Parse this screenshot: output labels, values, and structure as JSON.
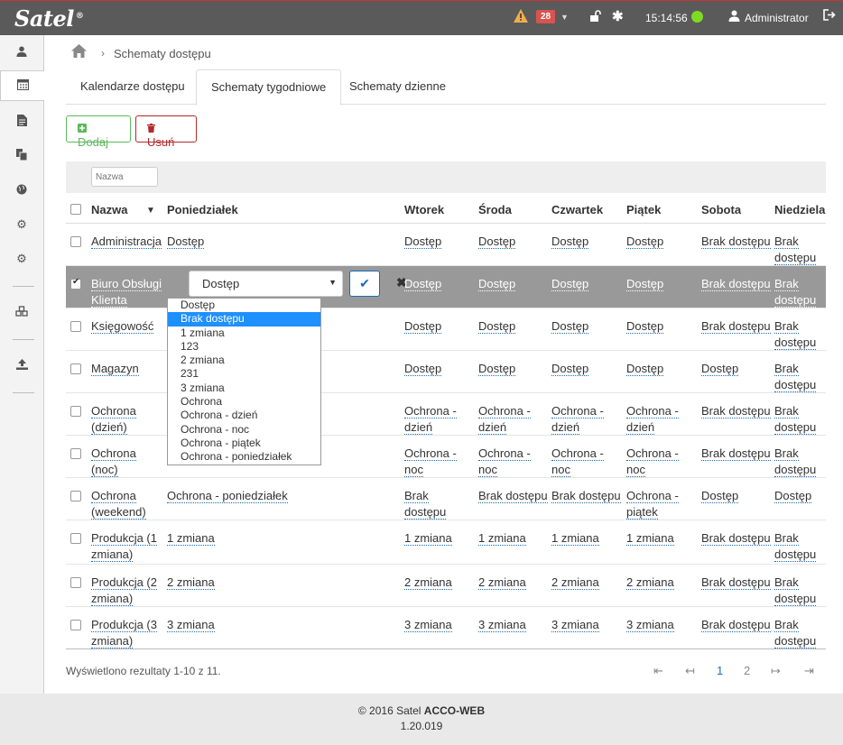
{
  "topbar": {
    "logo": "Satel",
    "alarm_count": "28",
    "clock": "15:14:56",
    "user": "Administrator",
    "status_color": "#7ddb21"
  },
  "breadcrumb": {
    "current": "Schematy dostępu"
  },
  "tabs": [
    {
      "label": "Kalendarze dostępu"
    },
    {
      "label": "Schematy tygodniowe"
    },
    {
      "label": "Schematy dzienne"
    }
  ],
  "toolbar": {
    "add_label": "Dodaj",
    "delete_label": "Usuń"
  },
  "filter": {
    "placeholder": "Nazwa"
  },
  "columns": [
    "Nazwa",
    "Poniedziałek",
    "Wtorek",
    "Środa",
    "Czwartek",
    "Piątek",
    "Sobota",
    "Niedziela"
  ],
  "rows": [
    {
      "name": [
        "Administracja"
      ],
      "mon": "Dostęp",
      "tue": [
        "Dostęp"
      ],
      "wed": [
        "Dostęp"
      ],
      "thu": [
        "Dostęp"
      ],
      "fri": [
        "Dostęp"
      ],
      "sat": [
        "Brak dostępu"
      ],
      "sun": [
        "Brak",
        "dostępu"
      ]
    },
    {
      "name": [
        "Biuro Obsługi",
        "Klienta"
      ],
      "mon": "Dostęp",
      "tue": [
        "Dostęp"
      ],
      "wed": [
        "Dostęp"
      ],
      "thu": [
        "Dostęp"
      ],
      "fri": [
        "Dostęp"
      ],
      "sat": [
        "Brak dostępu"
      ],
      "sun": [
        "Brak",
        "dostępu"
      ]
    },
    {
      "name": [
        "Księgowość"
      ],
      "mon": "",
      "tue": [
        "Dostęp"
      ],
      "wed": [
        "Dostęp"
      ],
      "thu": [
        "Dostęp"
      ],
      "fri": [
        "Dostęp"
      ],
      "sat": [
        "Brak dostępu"
      ],
      "sun": [
        "Brak",
        "dostępu"
      ]
    },
    {
      "name": [
        "Magazyn"
      ],
      "mon": "",
      "tue": [
        "Dostęp"
      ],
      "wed": [
        "Dostęp"
      ],
      "thu": [
        "Dostęp"
      ],
      "fri": [
        "Dostęp"
      ],
      "sat": [
        "Dostęp"
      ],
      "sun": [
        "Brak",
        "dostępu"
      ]
    },
    {
      "name": [
        "Ochrona",
        "(dzień)"
      ],
      "mon": "",
      "tue": [
        "Ochrona -",
        "dzień"
      ],
      "wed": [
        "Ochrona -",
        "dzień"
      ],
      "thu": [
        "Ochrona -",
        "dzień"
      ],
      "fri": [
        "Ochrona -",
        "dzień"
      ],
      "sat": [
        "Brak dostępu"
      ],
      "sun": [
        "Brak",
        "dostępu"
      ]
    },
    {
      "name": [
        "Ochrona",
        "(noc)"
      ],
      "mon": "",
      "tue": [
        "Ochrona -",
        "noc"
      ],
      "wed": [
        "Ochrona -",
        "noc"
      ],
      "thu": [
        "Ochrona -",
        "noc"
      ],
      "fri": [
        "Ochrona -",
        "noc"
      ],
      "sat": [
        "Brak dostępu"
      ],
      "sun": [
        "Brak",
        "dostępu"
      ]
    },
    {
      "name": [
        "Ochrona",
        "(weekend)"
      ],
      "mon": "Ochrona - poniedziałek",
      "tue": [
        "Brak",
        "dostępu"
      ],
      "wed": [
        "Brak dostępu"
      ],
      "thu": [
        "Brak dostępu"
      ],
      "fri": [
        "Ochrona -",
        "piątek"
      ],
      "sat": [
        "Dostęp"
      ],
      "sun": [
        "Dostęp"
      ]
    },
    {
      "name": [
        "Produkcja (1",
        "zmiana)"
      ],
      "mon": "1 zmiana",
      "tue": [
        "1 zmiana"
      ],
      "wed": [
        "1 zmiana"
      ],
      "thu": [
        "1 zmiana"
      ],
      "fri": [
        "1 zmiana"
      ],
      "sat": [
        "Brak dostępu"
      ],
      "sun": [
        "Brak",
        "dostępu"
      ]
    },
    {
      "name": [
        "Produkcja (2",
        "zmiana)"
      ],
      "mon": "2 zmiana",
      "tue": [
        "2 zmiana"
      ],
      "wed": [
        "2 zmiana"
      ],
      "thu": [
        "2 zmiana"
      ],
      "fri": [
        "2 zmiana"
      ],
      "sat": [
        "Brak dostępu"
      ],
      "sun": [
        "Brak",
        "dostępu"
      ]
    },
    {
      "name": [
        "Produkcja (3",
        "zmiana)"
      ],
      "mon": "3 zmiana",
      "tue": [
        "3 zmiana"
      ],
      "wed": [
        "3 zmiana"
      ],
      "thu": [
        "3 zmiana"
      ],
      "fri": [
        "3 zmiana"
      ],
      "sat": [
        "Brak dostępu"
      ],
      "sun": [
        "Brak",
        "dostępu"
      ]
    }
  ],
  "editor": {
    "selected": "Dostęp",
    "options": [
      "Dostęp",
      "Brak dostępu",
      "1 zmiana",
      "123",
      "2 zmiana",
      "231",
      "3 zmiana",
      "Ochrona",
      "Ochrona - dzień",
      "Ochrona - noc",
      "Ochrona - piątek",
      "Ochrona - poniedziałek"
    ],
    "highlighted_option": "Brak dostępu"
  },
  "footer_table": {
    "summary": "Wyświetlono rezultaty 1-10 z 11.",
    "pages": [
      "1",
      "2"
    ],
    "first": "⇤",
    "prev": "↤",
    "next": "↦",
    "last": "⇥"
  },
  "footer": {
    "copyright": "© 2016 Satel",
    "product": "ACCO-WEB",
    "version": "1.20.019"
  },
  "icons": {
    "warning": "warning-icon",
    "lock": "lock-open-icon",
    "asterisk": "asterisk-icon",
    "user": "user-icon",
    "logout": "logout-icon",
    "home": "home-icon"
  }
}
